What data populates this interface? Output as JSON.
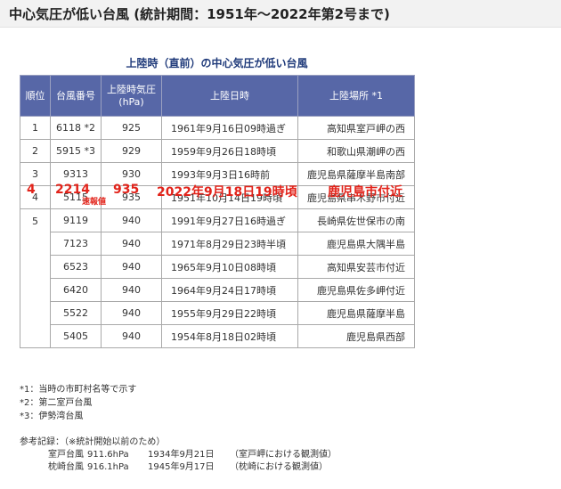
{
  "header": {
    "title": "中心気圧が低い台風 (統計期間：1951年〜2022年第2号まで)"
  },
  "table": {
    "caption": "上陸時（直前）の中心気圧が低い台風",
    "headers": {
      "rank": "順位",
      "typhoon_no": "台風番号",
      "pressure_line1": "上陸時気圧",
      "pressure_line2": "(hPa)",
      "date": "上陸日時",
      "place": "上陸場所 *1"
    },
    "rows": [
      {
        "rank": "1",
        "no": "6118 *2",
        "pressure": "925",
        "date": "1961年9月16日09時過ぎ",
        "place": "高知県室戸岬の西"
      },
      {
        "rank": "2",
        "no": "5915 *3",
        "pressure": "929",
        "date": "1959年9月26日18時頃",
        "place": "和歌山県潮岬の西"
      },
      {
        "rank": "3",
        "no": "9313",
        "pressure": "930",
        "date": "1993年9月3日16時前",
        "place": "鹿児島県薩摩半島南部"
      },
      {
        "rank": "4",
        "no": "5115",
        "pressure": "935",
        "date": "1951年10月14日19時頃",
        "place": "鹿児島県串木野市付近"
      },
      {
        "rank": "5",
        "no": "9119",
        "pressure": "940",
        "date": "1991年9月27日16時過ぎ",
        "place": "長崎県佐世保市の南"
      },
      {
        "rank": "",
        "no": "7123",
        "pressure": "940",
        "date": "1971年8月29日23時半頃",
        "place": "鹿児島県大隅半島"
      },
      {
        "rank": "",
        "no": "6523",
        "pressure": "940",
        "date": "1965年9月10日08時頃",
        "place": "高知県安芸市付近"
      },
      {
        "rank": "",
        "no": "6420",
        "pressure": "940",
        "date": "1964年9月24日17時頃",
        "place": "鹿児島県佐多岬付近"
      },
      {
        "rank": "",
        "no": "5522",
        "pressure": "940",
        "date": "1955年9月29日22時頃",
        "place": "鹿児島県薩摩半島"
      },
      {
        "rank": "",
        "no": "5405",
        "pressure": "940",
        "date": "1954年8月18日02時頃",
        "place": "鹿児島県西部"
      }
    ]
  },
  "overlay": {
    "rank": "4",
    "no": "2214",
    "pressure": "935",
    "date": "2022年9月18日19時頃",
    "place": "鹿児島市付近",
    "note": "速報値"
  },
  "footnotes": [
    "*1：当時の市町村名等で示す",
    "*2：第二室戸台風",
    "*3：伊勢湾台風"
  ],
  "reference": {
    "title": "参考記録：（※統計開始以前のため）",
    "records": [
      {
        "name": "室戸台風",
        "pressure": "911.6hPa",
        "date": "1934年9月21日",
        "note": "（室戸岬における観測値）"
      },
      {
        "name": "枕崎台風",
        "pressure": "916.1hPa",
        "date": "1945年9月17日",
        "note": "（枕崎における観測値）"
      }
    ]
  },
  "colors": {
    "header_bg": "#5767a7",
    "caption_text": "#1f3a7a",
    "overlay_red": "#e2231a"
  }
}
